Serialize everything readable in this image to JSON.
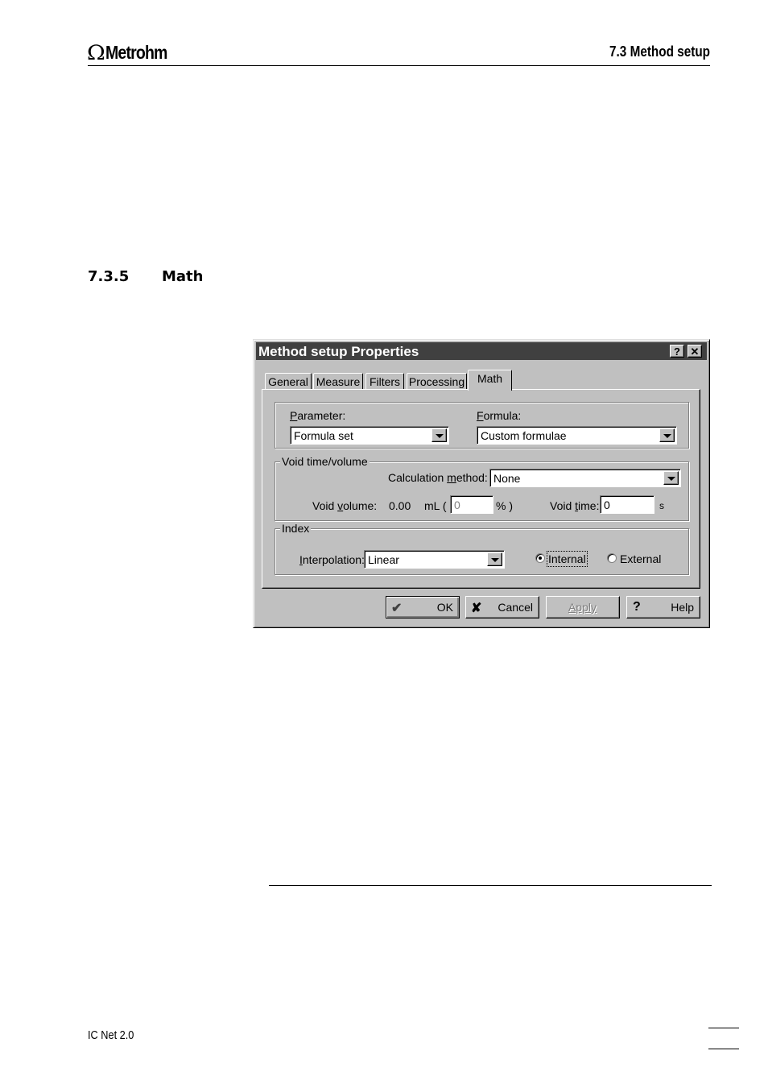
{
  "header": {
    "logo_symbol": "Ω",
    "logo_text": "Metrohm",
    "section_ref": "7.3  Method setup"
  },
  "section": {
    "number": "7.3.5",
    "title": "Math"
  },
  "dialog": {
    "title": "Method setup Properties",
    "help_glyph": "?",
    "close_glyph": "✕",
    "tabs": [
      "General",
      "Measure",
      "Filters",
      "Processing",
      "Math"
    ],
    "active_tab": "Math",
    "parameter": {
      "label_u": "P",
      "label_rest": "arameter:",
      "value": "Formula set"
    },
    "formula": {
      "label_u": "F",
      "label_rest": "ormula:",
      "value": "Custom formulae"
    },
    "void_group": {
      "legend": "Void time/volume",
      "calc_label_pre": "Calculation ",
      "calc_label_u": "m",
      "calc_label_post": "ethod:",
      "calc_value": "None",
      "void_volume_pre": "Void ",
      "void_volume_u": "v",
      "void_volume_post": "olume:",
      "void_volume_value": "0.00",
      "unit_open": "mL (",
      "percent_value": "0",
      "percent_close": "% )",
      "void_time_pre": "Void ",
      "void_time_u": "t",
      "void_time_post": "ime:",
      "void_time_value": "0",
      "void_time_unit": "s"
    },
    "index_group": {
      "legend": "Index",
      "interp_u": "I",
      "interp_rest": "nterpolation:",
      "interp_value": "Linear",
      "radio_internal": "Internal",
      "radio_external": "External",
      "selected": "Internal"
    },
    "buttons": {
      "ok": "OK",
      "ok_icon": "✔",
      "cancel": "Cancel",
      "cancel_icon": "✘",
      "apply": "Apply",
      "help": "Help",
      "help_icon": "?"
    }
  },
  "footer": {
    "product": "IC Net 2.0"
  }
}
